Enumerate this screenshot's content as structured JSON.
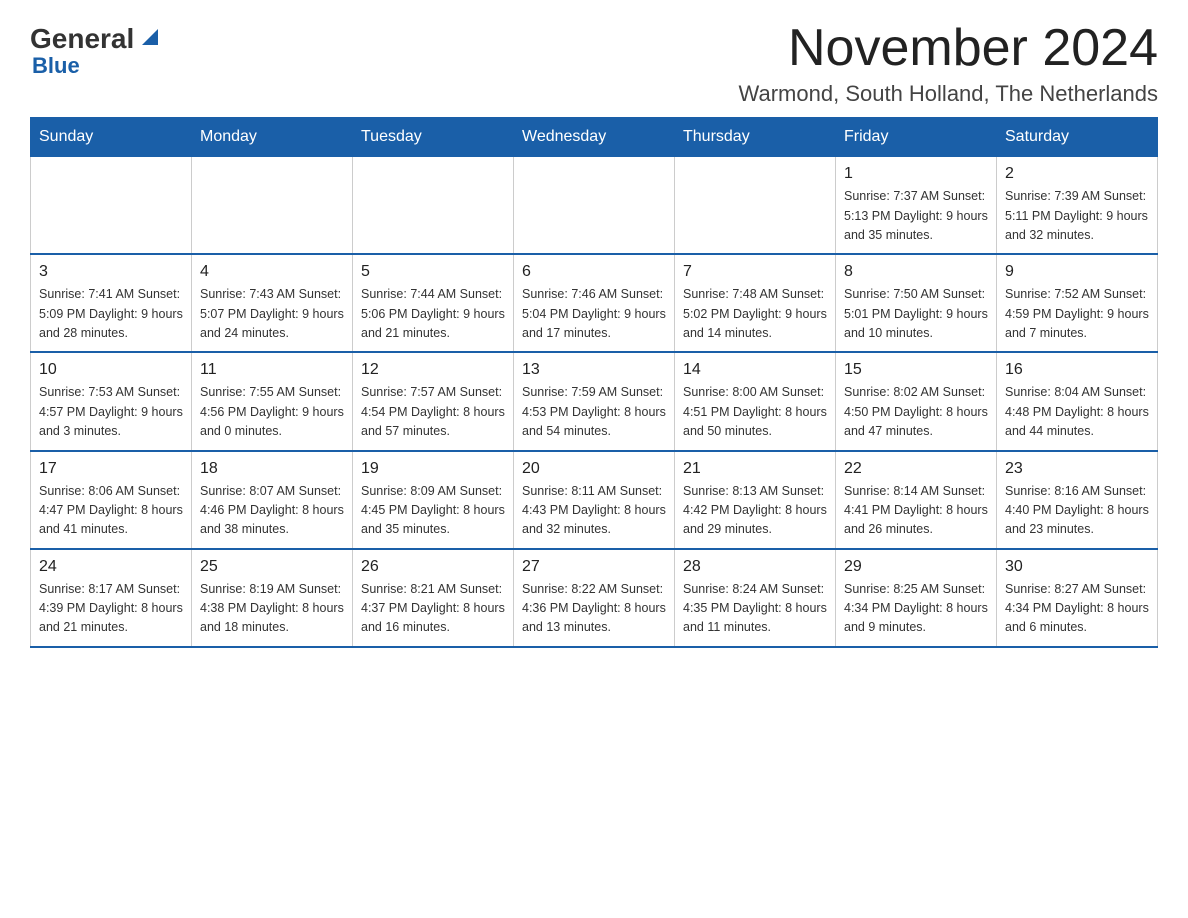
{
  "header": {
    "logo_general": "General",
    "logo_blue": "Blue",
    "month_title": "November 2024",
    "subtitle": "Warmond, South Holland, The Netherlands"
  },
  "calendar": {
    "days_of_week": [
      "Sunday",
      "Monday",
      "Tuesday",
      "Wednesday",
      "Thursday",
      "Friday",
      "Saturday"
    ],
    "weeks": [
      [
        {
          "day": "",
          "info": ""
        },
        {
          "day": "",
          "info": ""
        },
        {
          "day": "",
          "info": ""
        },
        {
          "day": "",
          "info": ""
        },
        {
          "day": "",
          "info": ""
        },
        {
          "day": "1",
          "info": "Sunrise: 7:37 AM\nSunset: 5:13 PM\nDaylight: 9 hours\nand 35 minutes."
        },
        {
          "day": "2",
          "info": "Sunrise: 7:39 AM\nSunset: 5:11 PM\nDaylight: 9 hours\nand 32 minutes."
        }
      ],
      [
        {
          "day": "3",
          "info": "Sunrise: 7:41 AM\nSunset: 5:09 PM\nDaylight: 9 hours\nand 28 minutes."
        },
        {
          "day": "4",
          "info": "Sunrise: 7:43 AM\nSunset: 5:07 PM\nDaylight: 9 hours\nand 24 minutes."
        },
        {
          "day": "5",
          "info": "Sunrise: 7:44 AM\nSunset: 5:06 PM\nDaylight: 9 hours\nand 21 minutes."
        },
        {
          "day": "6",
          "info": "Sunrise: 7:46 AM\nSunset: 5:04 PM\nDaylight: 9 hours\nand 17 minutes."
        },
        {
          "day": "7",
          "info": "Sunrise: 7:48 AM\nSunset: 5:02 PM\nDaylight: 9 hours\nand 14 minutes."
        },
        {
          "day": "8",
          "info": "Sunrise: 7:50 AM\nSunset: 5:01 PM\nDaylight: 9 hours\nand 10 minutes."
        },
        {
          "day": "9",
          "info": "Sunrise: 7:52 AM\nSunset: 4:59 PM\nDaylight: 9 hours\nand 7 minutes."
        }
      ],
      [
        {
          "day": "10",
          "info": "Sunrise: 7:53 AM\nSunset: 4:57 PM\nDaylight: 9 hours\nand 3 minutes."
        },
        {
          "day": "11",
          "info": "Sunrise: 7:55 AM\nSunset: 4:56 PM\nDaylight: 9 hours\nand 0 minutes."
        },
        {
          "day": "12",
          "info": "Sunrise: 7:57 AM\nSunset: 4:54 PM\nDaylight: 8 hours\nand 57 minutes."
        },
        {
          "day": "13",
          "info": "Sunrise: 7:59 AM\nSunset: 4:53 PM\nDaylight: 8 hours\nand 54 minutes."
        },
        {
          "day": "14",
          "info": "Sunrise: 8:00 AM\nSunset: 4:51 PM\nDaylight: 8 hours\nand 50 minutes."
        },
        {
          "day": "15",
          "info": "Sunrise: 8:02 AM\nSunset: 4:50 PM\nDaylight: 8 hours\nand 47 minutes."
        },
        {
          "day": "16",
          "info": "Sunrise: 8:04 AM\nSunset: 4:48 PM\nDaylight: 8 hours\nand 44 minutes."
        }
      ],
      [
        {
          "day": "17",
          "info": "Sunrise: 8:06 AM\nSunset: 4:47 PM\nDaylight: 8 hours\nand 41 minutes."
        },
        {
          "day": "18",
          "info": "Sunrise: 8:07 AM\nSunset: 4:46 PM\nDaylight: 8 hours\nand 38 minutes."
        },
        {
          "day": "19",
          "info": "Sunrise: 8:09 AM\nSunset: 4:45 PM\nDaylight: 8 hours\nand 35 minutes."
        },
        {
          "day": "20",
          "info": "Sunrise: 8:11 AM\nSunset: 4:43 PM\nDaylight: 8 hours\nand 32 minutes."
        },
        {
          "day": "21",
          "info": "Sunrise: 8:13 AM\nSunset: 4:42 PM\nDaylight: 8 hours\nand 29 minutes."
        },
        {
          "day": "22",
          "info": "Sunrise: 8:14 AM\nSunset: 4:41 PM\nDaylight: 8 hours\nand 26 minutes."
        },
        {
          "day": "23",
          "info": "Sunrise: 8:16 AM\nSunset: 4:40 PM\nDaylight: 8 hours\nand 23 minutes."
        }
      ],
      [
        {
          "day": "24",
          "info": "Sunrise: 8:17 AM\nSunset: 4:39 PM\nDaylight: 8 hours\nand 21 minutes."
        },
        {
          "day": "25",
          "info": "Sunrise: 8:19 AM\nSunset: 4:38 PM\nDaylight: 8 hours\nand 18 minutes."
        },
        {
          "day": "26",
          "info": "Sunrise: 8:21 AM\nSunset: 4:37 PM\nDaylight: 8 hours\nand 16 minutes."
        },
        {
          "day": "27",
          "info": "Sunrise: 8:22 AM\nSunset: 4:36 PM\nDaylight: 8 hours\nand 13 minutes."
        },
        {
          "day": "28",
          "info": "Sunrise: 8:24 AM\nSunset: 4:35 PM\nDaylight: 8 hours\nand 11 minutes."
        },
        {
          "day": "29",
          "info": "Sunrise: 8:25 AM\nSunset: 4:34 PM\nDaylight: 8 hours\nand 9 minutes."
        },
        {
          "day": "30",
          "info": "Sunrise: 8:27 AM\nSunset: 4:34 PM\nDaylight: 8 hours\nand 6 minutes."
        }
      ]
    ]
  }
}
